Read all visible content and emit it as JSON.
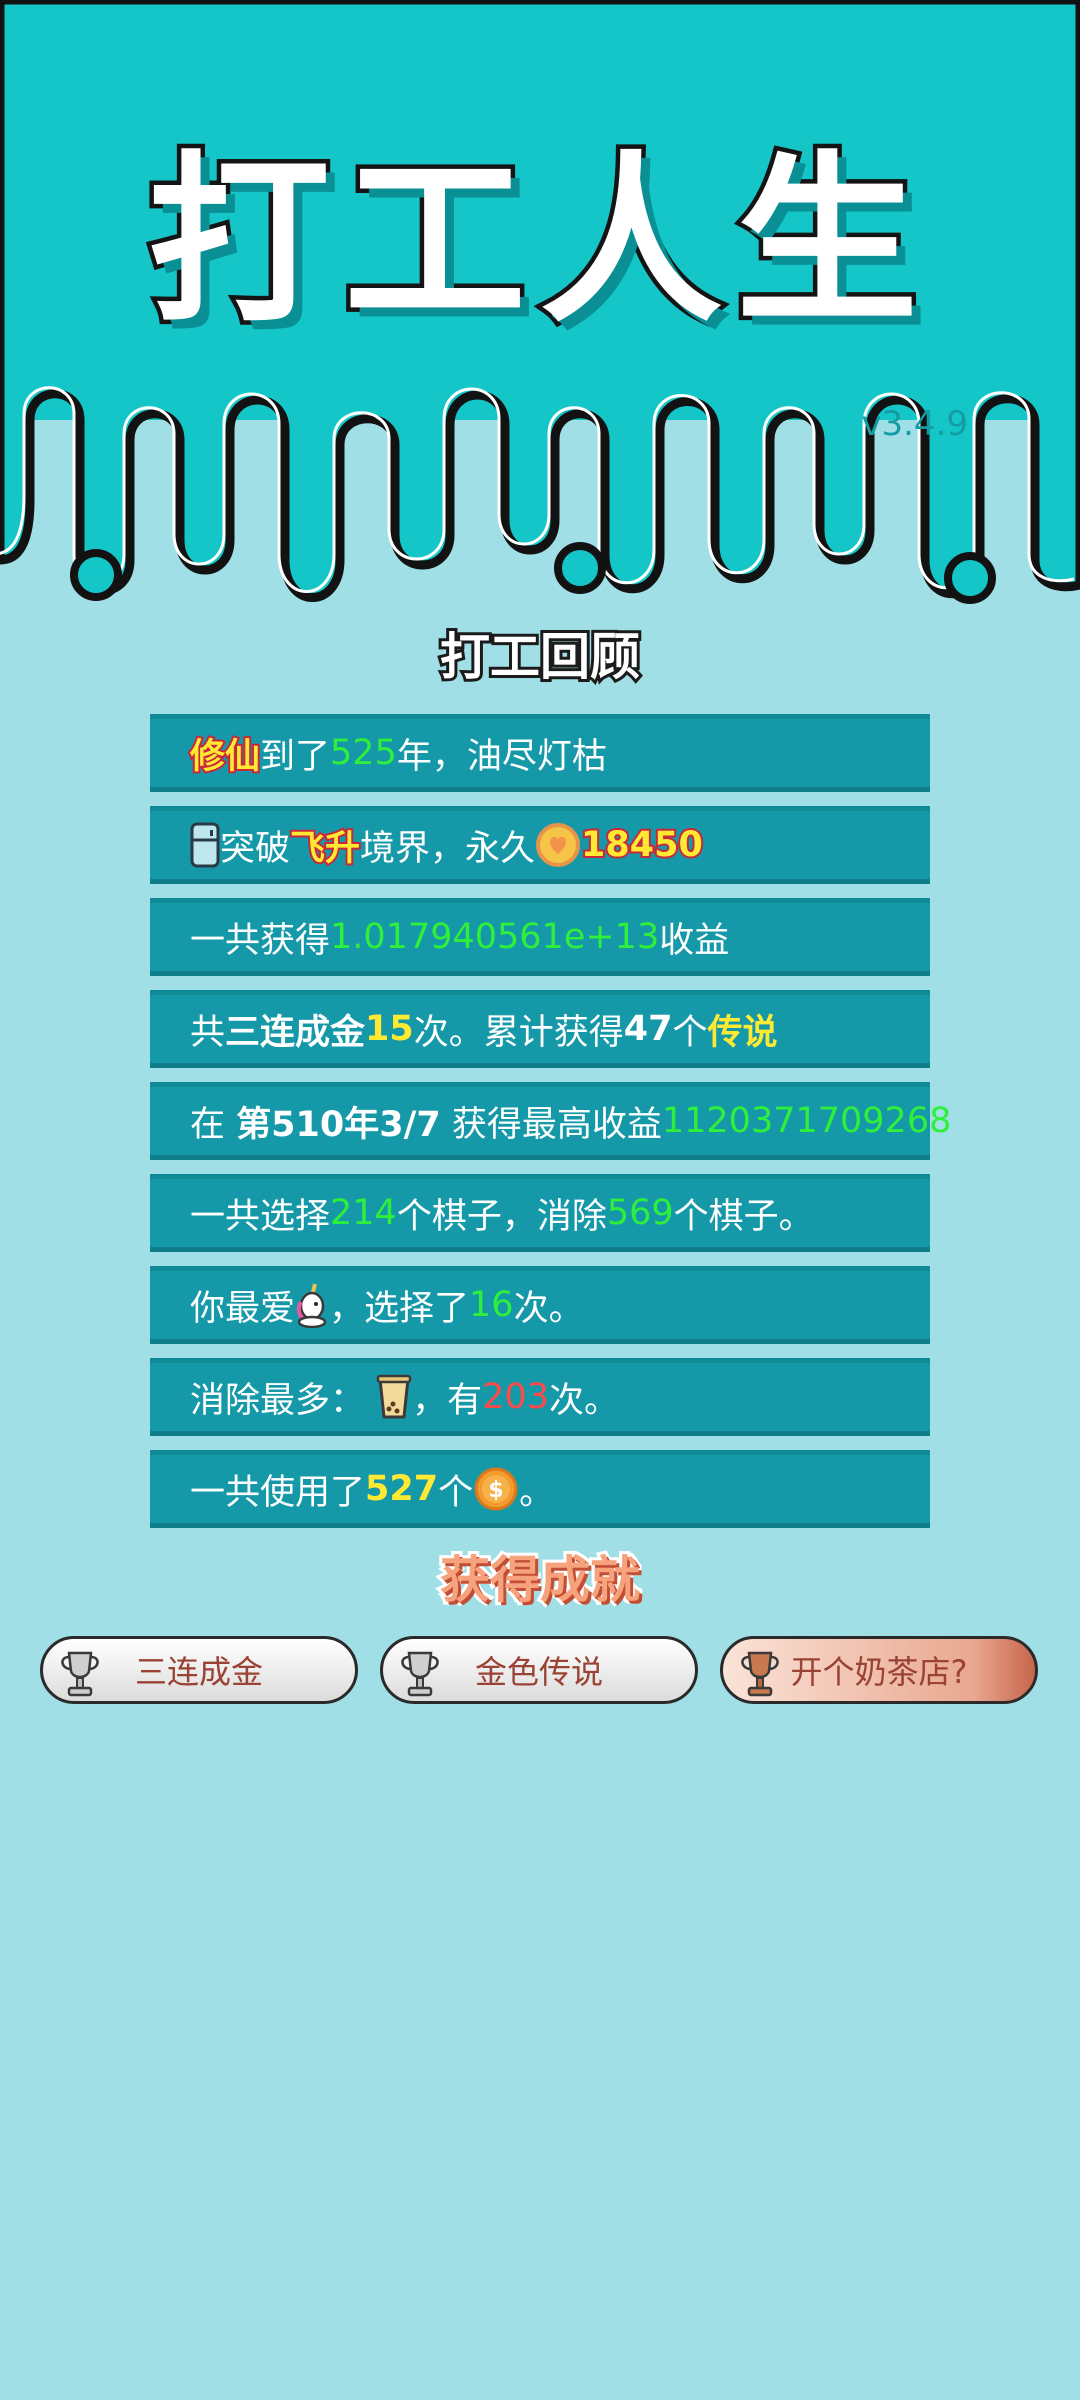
{
  "app": {
    "title": "打工人生",
    "version": "v3.4.9"
  },
  "review": {
    "title": "打工回顾",
    "rows": [
      {
        "a": "修仙",
        "b": "到了",
        "c": "525",
        "d": "年，油尽灯枯"
      },
      {
        "a": "突破",
        "b": "飞升",
        "c": "境界，永久",
        "d": "18450"
      },
      {
        "a": "一共获得",
        "b": "1.017940561e+13",
        "c": "收益"
      },
      {
        "a": "共",
        "b": "三连成金",
        "c": "15",
        "d": "次。累计获得",
        "e": "47",
        "f": "个",
        "g": "传说"
      },
      {
        "a": "在",
        "b": "第510年3/7",
        "c": "获得最高收益",
        "d": "1120371709268"
      },
      {
        "a": "一共选择",
        "b": "214",
        "c": "个棋子，消除",
        "d": "569",
        "e": "个棋子。"
      },
      {
        "a": "你最爱",
        "b": "，选择了",
        "c": "16",
        "d": "次。"
      },
      {
        "a": "消除最多：",
        "b": "，有",
        "c": "203",
        "d": "次。"
      },
      {
        "a": "一共使用了",
        "b": "527",
        "c": "个",
        "d": "。"
      }
    ]
  },
  "achievements": {
    "title": "获得成就",
    "items": [
      {
        "label": "三连成金",
        "tier": "silver"
      },
      {
        "label": "金色传说",
        "tier": "silver"
      },
      {
        "label": "开个奶茶店?",
        "tier": "bronze"
      }
    ]
  },
  "colors": {
    "top_band": "#14c6c8",
    "background": "#a0dfe6",
    "row": "#1599a8",
    "highlight_green": "#2ef03a",
    "highlight_yellow": "#ffe933",
    "highlight_red": "#ff4a4a"
  }
}
